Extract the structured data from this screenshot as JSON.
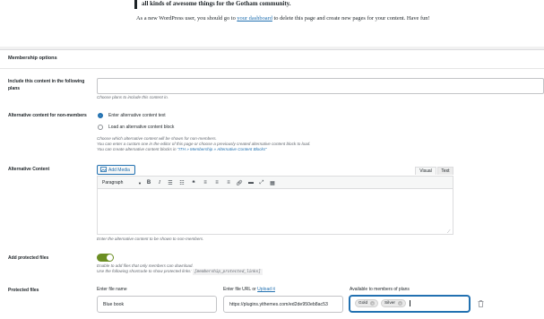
{
  "content": {
    "paragraph_1": "all kinds of awesome things for the Gotham community.",
    "paragraph_2_before": "As a new WordPress user, you should go to ",
    "paragraph_2_link": "your dashboard",
    "paragraph_2_after": " to delete this page and create new pages for your content. Have fun!"
  },
  "membership": {
    "section_title": "Membership options",
    "include_label": "Include this content in the following plans",
    "include_help": "Choose plans to include this content in.",
    "alt_label": "Alternative content for non-members",
    "radio_1": "Enter alternative content text",
    "radio_2": "Load an alternative content block",
    "radio_help_1": "Choose which alternative content will be shown for non-members.",
    "radio_help_2": "You can enter a custom one in the editor of this page or choose a previously created alternative content block to load.",
    "radio_help_3_prefix": "You can create alternative content blocks in ",
    "radio_help_3_link": "\"ITH » Membership » Alternative Content Blocks\"",
    "alt_content_label": "Alternative Content",
    "add_media": "Add Media",
    "tab_visual": "Visual",
    "tab_text": "Text",
    "format_select": "Paragraph",
    "editor_help": "Enter the alternative content to be shown to non-members.",
    "protected_label": "Add protected files",
    "protected_help_1": "Enable to add files that only members can download.",
    "protected_help_2": "Use the following shortcode to show protected links:",
    "shortcode": "[membership_protected_links]",
    "files_label": "Protected files",
    "file_name_label": "Enter file name",
    "file_url_label": "Enter file URL or",
    "upload_link": "Upload it",
    "avail_label": "Available to members of plans",
    "file_name_value": "Blue book",
    "file_url_value": "https://plugins.yithemes.com/ed2de950eb8ac53",
    "chips": [
      "Gold",
      "Silver"
    ]
  },
  "icons": {
    "add_media": "media-icon",
    "chip_remove": "remove-chip-icon",
    "delete_row": "trash-icon"
  },
  "colors": {
    "accent": "#2271b1",
    "toggle_on": "#6b8e23"
  }
}
